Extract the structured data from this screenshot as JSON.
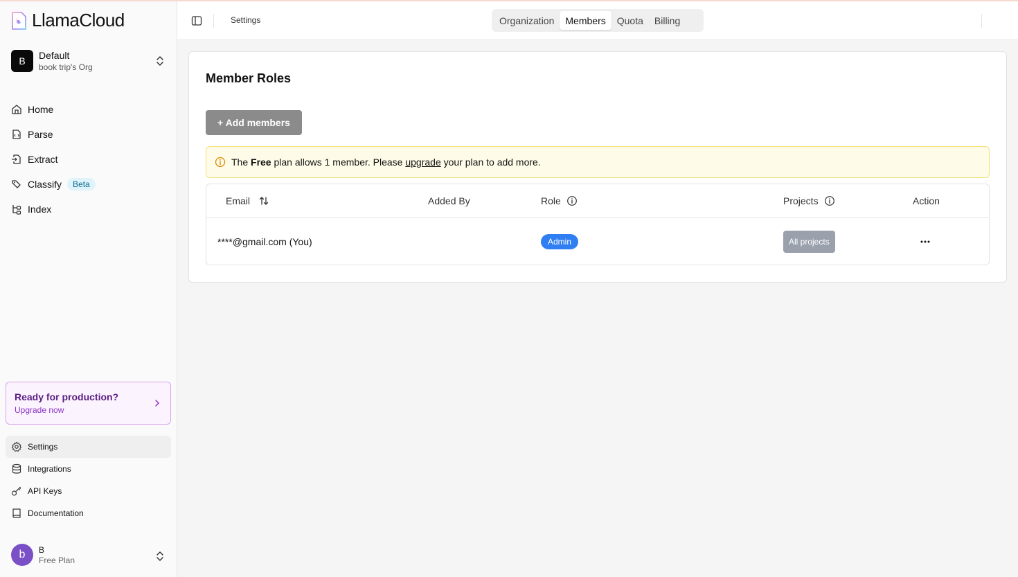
{
  "app": {
    "name": "LlamaCloud"
  },
  "org": {
    "avatar": "B",
    "name": "Default",
    "subtitle": "book trip's Org"
  },
  "nav": [
    {
      "label": "Home",
      "icon": "home-icon"
    },
    {
      "label": "Parse",
      "icon": "file-code-icon"
    },
    {
      "label": "Extract",
      "icon": "file-export-icon"
    },
    {
      "label": "Classify",
      "icon": "tags-icon",
      "badge": "Beta"
    },
    {
      "label": "Index",
      "icon": "tree-icon"
    }
  ],
  "promo": {
    "title": "Ready for production?",
    "subtitle": "Upgrade now"
  },
  "bottom_nav": [
    {
      "label": "Settings",
      "icon": "gear-icon",
      "active": true
    },
    {
      "label": "Integrations",
      "icon": "database-icon"
    },
    {
      "label": "API Keys",
      "icon": "key-icon"
    },
    {
      "label": "Documentation",
      "icon": "book-icon"
    }
  ],
  "user": {
    "avatar": "b",
    "name": "B",
    "plan": "Free Plan"
  },
  "header": {
    "breadcrumb": "Settings",
    "tabs": [
      {
        "label": "Organization",
        "active": false
      },
      {
        "label": "Members",
        "active": true
      },
      {
        "label": "Quota",
        "active": false
      },
      {
        "label": "Billing",
        "active": false
      }
    ]
  },
  "main": {
    "title": "Member Roles",
    "add_button": "+ Add members",
    "alert": {
      "part1": "The ",
      "plan": "Free",
      "part2": " plan allows 1 member. Please ",
      "link": "upgrade",
      "part3": " your plan to add more."
    },
    "table": {
      "columns": {
        "email": "Email",
        "added_by": "Added By",
        "role": "Role",
        "projects": "Projects",
        "action": "Action"
      },
      "rows": [
        {
          "email": "****@gmail.com (You)",
          "added_by": "",
          "role": "Admin",
          "projects": "All projects"
        }
      ]
    }
  },
  "colors": {
    "role_badge": "#2f7ff2",
    "beta_badge": "#dff3fb",
    "promo_border": "#d8a5ee",
    "alert_bg": "#fefce8"
  }
}
